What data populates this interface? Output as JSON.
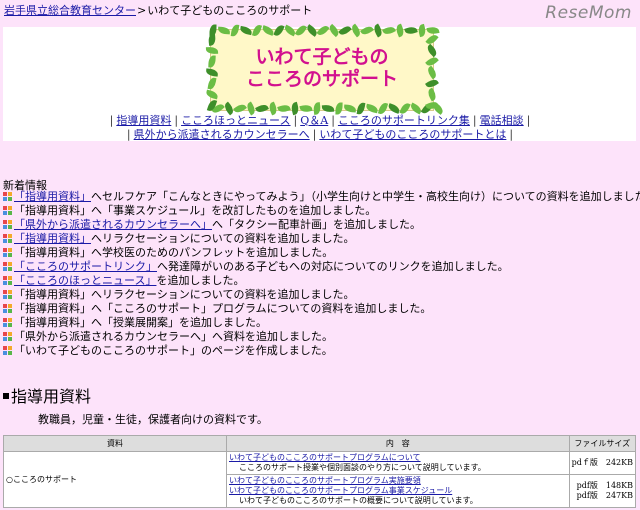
{
  "header": {
    "breadcrumb_link": "岩手県立総合教育センター",
    "breadcrumb_sep": ">",
    "breadcrumb_current": "いわて子どものこころのサポート",
    "watermark": "ReseMom"
  },
  "logo": {
    "line1": "いわて子どもの",
    "line2": "こころのサポート"
  },
  "nav": {
    "row1": [
      "指導用資料",
      "こころほっとニュース",
      "Q＆A",
      "こころのサポートリンク集",
      "電話相談"
    ],
    "row2": [
      "県外から派遣されるカウンセラーへ",
      "いわて子どものこころのサポートとは"
    ]
  },
  "news": {
    "title": "新着情報",
    "items": [
      {
        "link": "「指導用資料」",
        "text": "へセルフケア「こんなときにやってみよう」（小学生向けと中学生・高校生向け）についての資料を追加しました。"
      },
      {
        "link": "",
        "text": "「指導用資料」へ「事業スケジュール」を改訂したものを追加しました。"
      },
      {
        "link": "「県外から派遣されるカウンセラーへ」",
        "text": "へ「タクシー配車計画」を追加しました。"
      },
      {
        "link": "「指導用資料」",
        "text": "へリラクセーションについての資料を追加しました。"
      },
      {
        "link": "",
        "text": "「指導用資料」へ学校医のためのパンフレットを追加しました。"
      },
      {
        "link": "「こころのサポートリンク」",
        "text": "へ発達障がいのある子どもへの対応についてのリンクを追加しました。"
      },
      {
        "link": "「こころのほっとニュース」",
        "text": "を追加しました。"
      },
      {
        "link": "",
        "text": "「指導用資料」へリラクセーションについての資料を追加しました。"
      },
      {
        "link": "",
        "text": "「指導用資料」へ「こころのサポート」プログラムについての資料を追加しました。"
      },
      {
        "link": "",
        "text": "「指導用資料」へ「授業展開案」を追加しました。"
      },
      {
        "link": "",
        "text": "「県外から派遣されるカウンセラーへ」へ資料を追加しました。"
      },
      {
        "link": "",
        "text": "「いわて子どものこころのサポート」のページを作成しました。"
      }
    ]
  },
  "section": {
    "heading": "指導用資料",
    "description": "教職員，児童・生徒，保護者向けの資料です。"
  },
  "table": {
    "headers": [
      "資料",
      "内　容",
      "ファイルサイズ"
    ],
    "row1": {
      "category": "○こころのサポート",
      "a_title": "いわて子どものこころのサポートプログラムについて",
      "a_desc": "こころのサポート授業や個別面談のやり方について説明しています。",
      "a_size": "pdｆ版　242KB",
      "b_title1": "いわて子どものこころのサポートプログラム実施要領",
      "b_title2": "いわて子どものこころのサポートプログラム事業スケジュール",
      "b_desc": "いわて子どものこころのサポートの概要について説明しています。",
      "b_size1": "pdf版　148KB",
      "b_size2": "pdf版　247KB"
    }
  },
  "colors": {
    "background": "#fde3fa",
    "link": "#1a1aa6",
    "logo_text": "#d2108f",
    "leaf": "#58a83a"
  }
}
